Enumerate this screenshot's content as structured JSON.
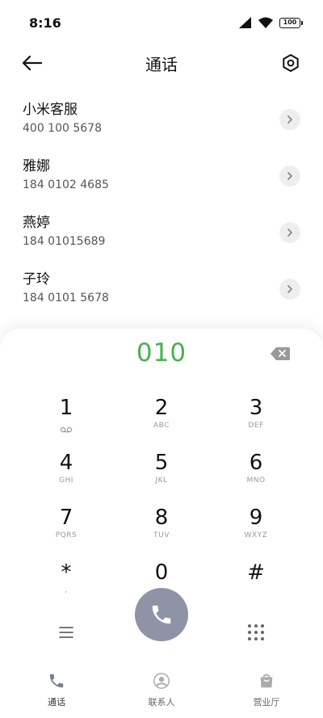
{
  "status": {
    "time": "8:16",
    "battery": "100"
  },
  "header": {
    "title": "通话"
  },
  "contacts": [
    {
      "name": "小米客服",
      "number": "400 100 5678"
    },
    {
      "name": "雅娜",
      "number": "184 0102 4685"
    },
    {
      "name": "燕婷",
      "number": "184 01015689"
    },
    {
      "name": "子玲",
      "number": "184 0101 5678"
    }
  ],
  "dialer": {
    "display": "010",
    "keys": [
      {
        "digit": "1",
        "letters": ""
      },
      {
        "digit": "2",
        "letters": "ABC"
      },
      {
        "digit": "3",
        "letters": "DEF"
      },
      {
        "digit": "4",
        "letters": "GHI"
      },
      {
        "digit": "5",
        "letters": "JKL"
      },
      {
        "digit": "6",
        "letters": "MNO"
      },
      {
        "digit": "7",
        "letters": "PQRS"
      },
      {
        "digit": "8",
        "letters": "TUV"
      },
      {
        "digit": "9",
        "letters": "WXYZ"
      },
      {
        "digit": "*",
        "letters": ","
      },
      {
        "digit": "0",
        "letters": ""
      },
      {
        "digit": "#",
        "letters": ""
      }
    ]
  },
  "nav": [
    {
      "label": "通话"
    },
    {
      "label": "联系人"
    },
    {
      "label": "营业厅"
    }
  ],
  "colors": {
    "accent": "#4caf50",
    "call_button": "#8e93a6"
  }
}
